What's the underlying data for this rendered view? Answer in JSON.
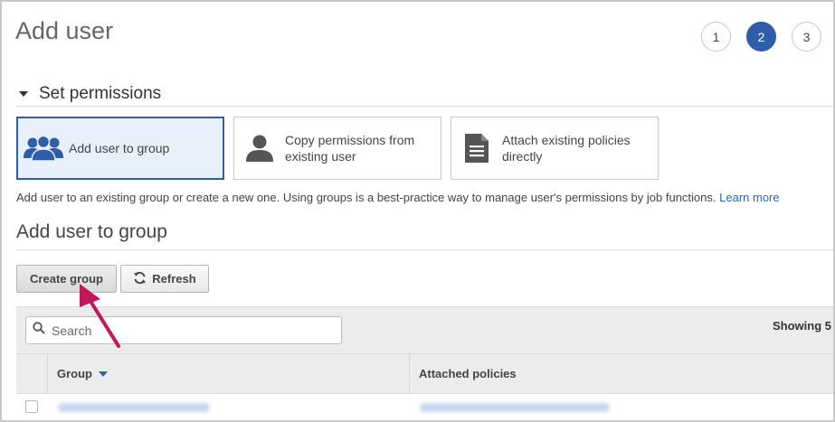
{
  "page": {
    "title": "Add user"
  },
  "steps": [
    "1",
    "2",
    "3"
  ],
  "active_step": "2",
  "set_permissions": {
    "title": "Set permissions",
    "options": [
      {
        "label": "Add user to group",
        "icon": "users-group-icon",
        "selected": true
      },
      {
        "label": "Copy permissions from existing user",
        "icon": "user-icon",
        "selected": false
      },
      {
        "label": "Attach existing policies directly",
        "icon": "document-icon",
        "selected": false
      }
    ],
    "description": "Add user to an existing group or create a new one. Using groups is a best-practice way to manage user's permissions by job functions.",
    "learn_more": "Learn more"
  },
  "add_to_group": {
    "title": "Add user to group",
    "create_group_label": "Create group",
    "refresh_label": "Refresh",
    "search_placeholder": "Search",
    "showing_text": "Showing 5",
    "columns": {
      "group": "Group",
      "attached_policies": "Attached policies"
    }
  },
  "colors": {
    "accent": "#2f5ea8",
    "link": "#2f66b8",
    "annotation": "#c2185b"
  }
}
